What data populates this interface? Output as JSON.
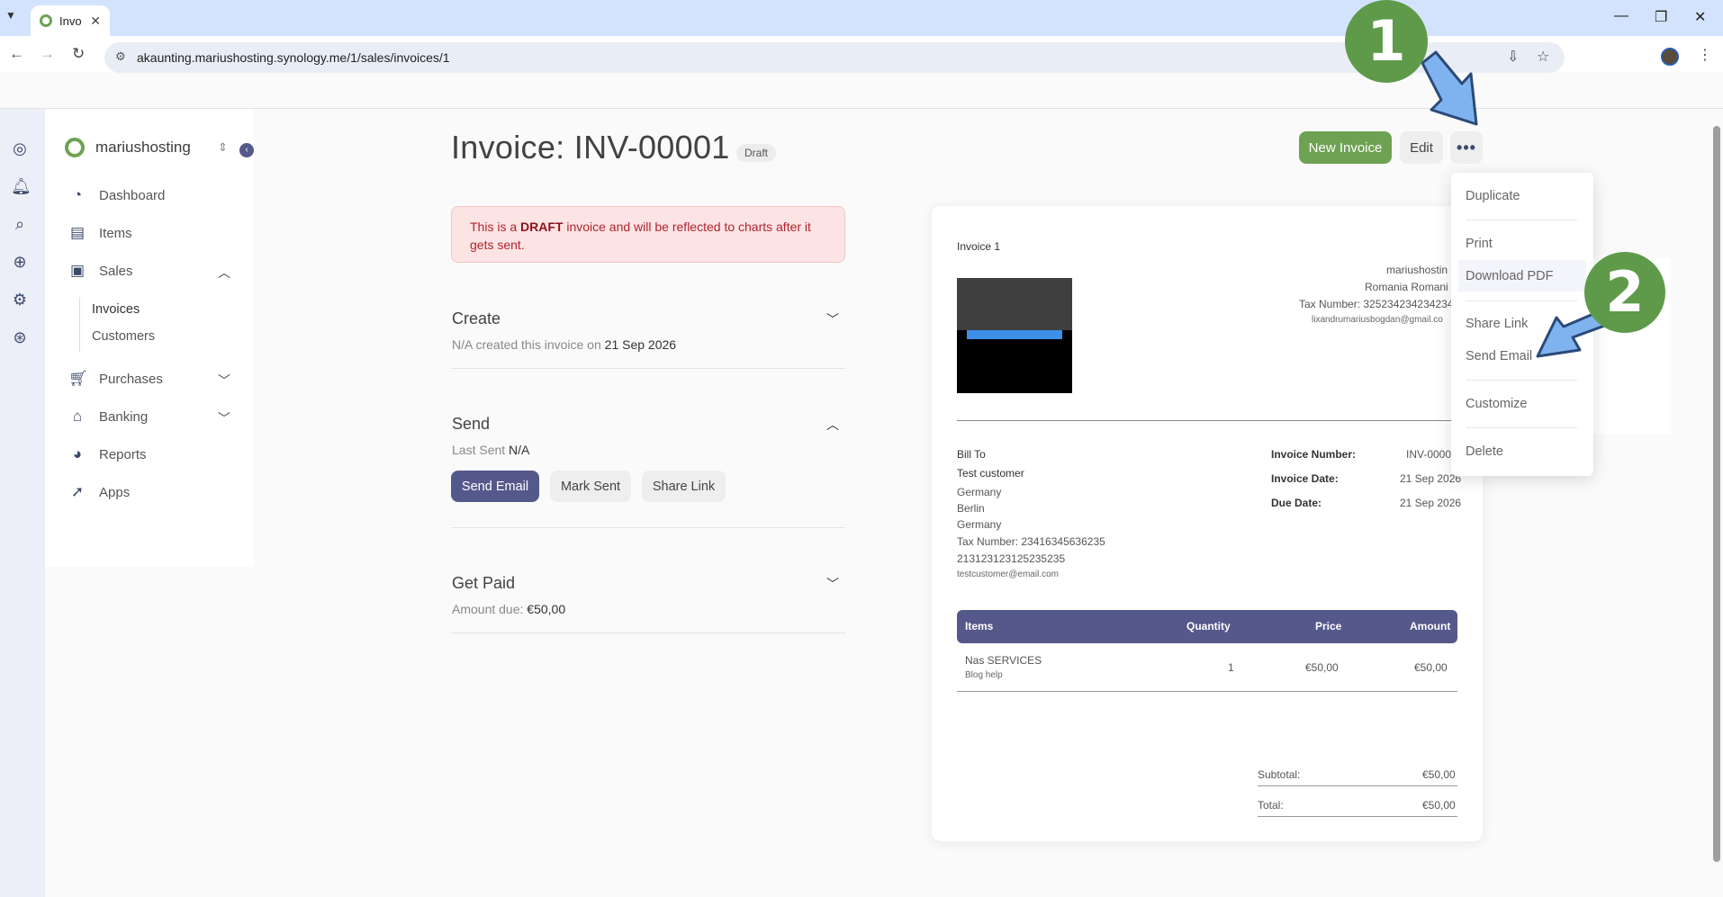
{
  "browser": {
    "tab_title": "Invo",
    "tab_close": "✕",
    "url": "akaunting.mariushosting.synology.me/1/sales/invoices/1"
  },
  "sidebar": {
    "company": "mariushosting",
    "nav": [
      {
        "label": "Dashboard",
        "icon": "dashboard-icon"
      },
      {
        "label": "Items",
        "icon": "box-icon"
      },
      {
        "label": "Sales",
        "icon": "money-icon"
      },
      {
        "label": "Purchases",
        "icon": "cart-icon"
      },
      {
        "label": "Banking",
        "icon": "bank-icon"
      },
      {
        "label": "Reports",
        "icon": "pie-chart-icon"
      },
      {
        "label": "Apps",
        "icon": "rocket-icon"
      }
    ],
    "sales_sub": [
      "Invoices",
      "Customers"
    ],
    "rail_icons": [
      "profile-icon",
      "bell-icon",
      "search-icon",
      "plus-circle-icon",
      "gear-icon",
      "support-icon"
    ]
  },
  "header": {
    "title": "Invoice: INV-00001",
    "status_badge": "Draft",
    "new_invoice": "New Invoice",
    "edit": "Edit",
    "more": "•••"
  },
  "alert": {
    "pre": "This is a ",
    "bold": "DRAFT",
    "post": " invoice and will be reflected to charts after it gets sent."
  },
  "sections": {
    "create": {
      "title": "Create",
      "sub_pre": "N/A created this invoice on ",
      "date": "21 Sep 2026"
    },
    "send": {
      "title": "Send",
      "sub_pre": "Last Sent ",
      "last_sent": "N/A",
      "send_email": "Send Email",
      "mark_sent": "Mark Sent",
      "share_link": "Share Link"
    },
    "get_paid": {
      "title": "Get Paid",
      "sub_pre": "Amount due: ",
      "amount": "€50,00"
    }
  },
  "invoice": {
    "heading": "Invoice 1",
    "company_lines": [
      "mariushostin",
      "Romania Romani",
      "Tax Number: 325234234234234",
      "lixandrumariusbogdan@gmail.co"
    ],
    "bill_to_label": "Bill To",
    "customer_lines": [
      "Test customer",
      "Germany",
      "Berlin",
      "Germany",
      "Tax Number: 23416345636235",
      "213123123125235235",
      "testcustomer@email.com"
    ],
    "meta": [
      {
        "label": "Invoice Number:",
        "value": "INV-0000"
      },
      {
        "label": "Invoice Date:",
        "value": "21 Sep 2026"
      },
      {
        "label": "Due Date:",
        "value": "21 Sep 2026"
      }
    ],
    "columns": [
      "Items",
      "Quantity",
      "Price",
      "Amount"
    ],
    "rows": [
      {
        "name": "Nas SERVICES",
        "desc": "Blog help",
        "qty": "1",
        "price": "€50,00",
        "amount": "€50,00"
      }
    ],
    "subtotal_label": "Subtotal:",
    "subtotal": "€50,00",
    "total_label": "Total:",
    "total": "€50,00"
  },
  "menu": {
    "items": [
      "Duplicate",
      "Print",
      "Download PDF",
      "Share Link",
      "Send Email",
      "Customize",
      "Delete"
    ]
  },
  "annotations": {
    "step1": "1",
    "step2": "2"
  },
  "colors": {
    "brand_green": "#6da252",
    "accent_indigo": "#55588b",
    "arrow_blue": "#7fb3f0"
  }
}
